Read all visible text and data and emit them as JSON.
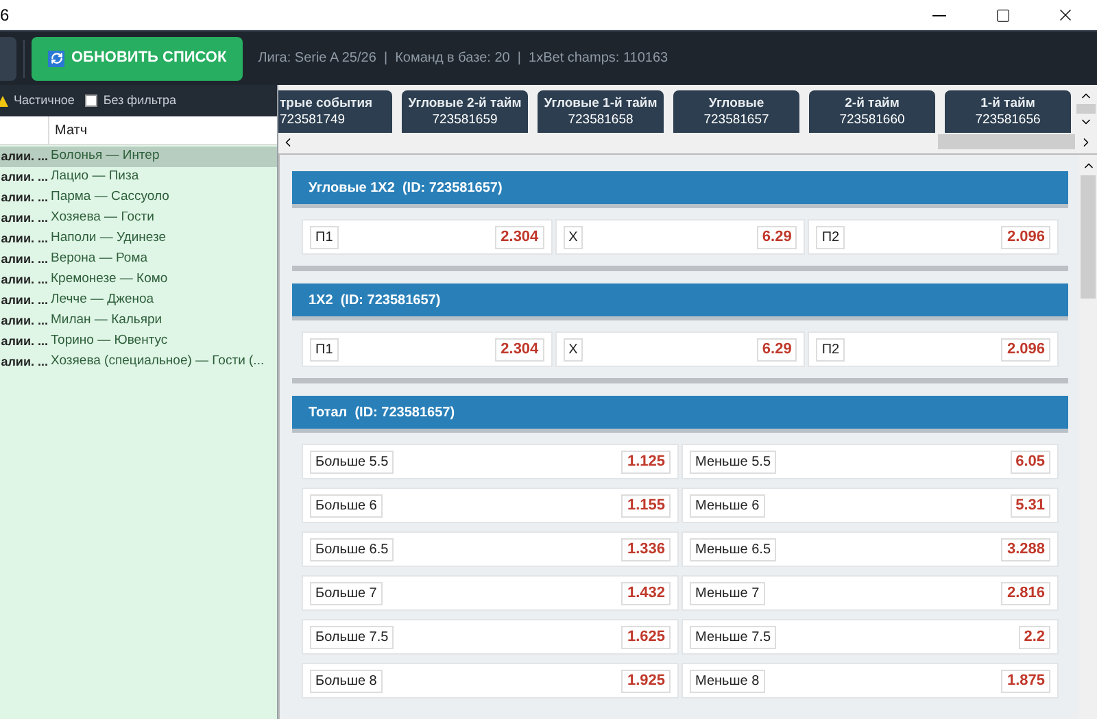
{
  "window": {
    "title": "6"
  },
  "toolbar": {
    "refresh_button": "ОБНОВИТЬ СПИСОК",
    "info": "Лига: Serie A 25/26  |  Команд в базе: 20  |  1xBet champs: 110163"
  },
  "filters": [
    {
      "kind": "warning",
      "label": "Частичное"
    },
    {
      "kind": "checkbox",
      "label": "Без фильтра",
      "checked": false
    }
  ],
  "table": {
    "columns": [
      "Матч"
    ],
    "rows": [
      {
        "column_1": "алии. ...",
        "match": "Болонья — Интер",
        "selected": true
      },
      {
        "column_1": "алии. ...",
        "match": "Лацио — Пиза",
        "selected": false
      },
      {
        "column_1": "алии. ...",
        "match": "Парма — Сассуоло",
        "selected": false
      },
      {
        "column_1": "алии. ...",
        "match": "Хозяева — Гости",
        "selected": false
      },
      {
        "column_1": "алии. ...",
        "match": "Наполи — Удинезе",
        "selected": false
      },
      {
        "column_1": "алии. ...",
        "match": "Верона — Рома",
        "selected": false
      },
      {
        "column_1": "алии. ...",
        "match": "Кремонезе — Комо",
        "selected": false
      },
      {
        "column_1": "алии. ...",
        "match": "Лечче — Дженоа",
        "selected": false
      },
      {
        "column_1": "алии. ...",
        "match": "Милан — Кальяри",
        "selected": false
      },
      {
        "column_1": "алии. ...",
        "match": "Торино — Ювентус",
        "selected": false
      },
      {
        "column_1": "алии. ...",
        "match": "Хозяева (специальное) — Гости (...",
        "selected": false
      }
    ]
  },
  "tabs": [
    {
      "label": "трые события",
      "id": "723581749"
    },
    {
      "label": "Угловые 2-й тайм",
      "id": "723581659"
    },
    {
      "label": "Угловые 1-й тайм",
      "id": "723581658"
    },
    {
      "label": "Угловые",
      "id": "723581657"
    },
    {
      "label": "2-й тайм",
      "id": "723581660"
    },
    {
      "label": "1-й тайм",
      "id": "723581656"
    }
  ],
  "sections": [
    {
      "title": "Угловые 1X2  (ID: 723581657)",
      "rows": [
        [
          {
            "label": "П1",
            "odds": "2.304"
          },
          {
            "label": "X",
            "odds": "6.29"
          },
          {
            "label": "П2",
            "odds": "2.096"
          }
        ]
      ]
    },
    {
      "title": "1X2  (ID: 723581657)",
      "rows": [
        [
          {
            "label": "П1",
            "odds": "2.304"
          },
          {
            "label": "X",
            "odds": "6.29"
          },
          {
            "label": "П2",
            "odds": "2.096"
          }
        ]
      ]
    },
    {
      "title": "Тотал  (ID: 723581657)",
      "rows": [
        [
          {
            "label": "Больше 5.5",
            "odds": "1.125"
          },
          {
            "label": "Меньше 5.5",
            "odds": "6.05"
          }
        ],
        [
          {
            "label": "Больше 6",
            "odds": "1.155"
          },
          {
            "label": "Меньше 6",
            "odds": "5.31"
          }
        ],
        [
          {
            "label": "Больше 6.5",
            "odds": "1.336"
          },
          {
            "label": "Меньше 6.5",
            "odds": "3.288"
          }
        ],
        [
          {
            "label": "Больше 7",
            "odds": "1.432"
          },
          {
            "label": "Меньше 7",
            "odds": "2.816"
          }
        ],
        [
          {
            "label": "Больше 7.5",
            "odds": "1.625"
          },
          {
            "label": "Меньше 7.5",
            "odds": "2.2"
          }
        ],
        [
          {
            "label": "Больше 8",
            "odds": "1.925"
          },
          {
            "label": "Меньше 8",
            "odds": "1.875"
          }
        ]
      ]
    }
  ]
}
